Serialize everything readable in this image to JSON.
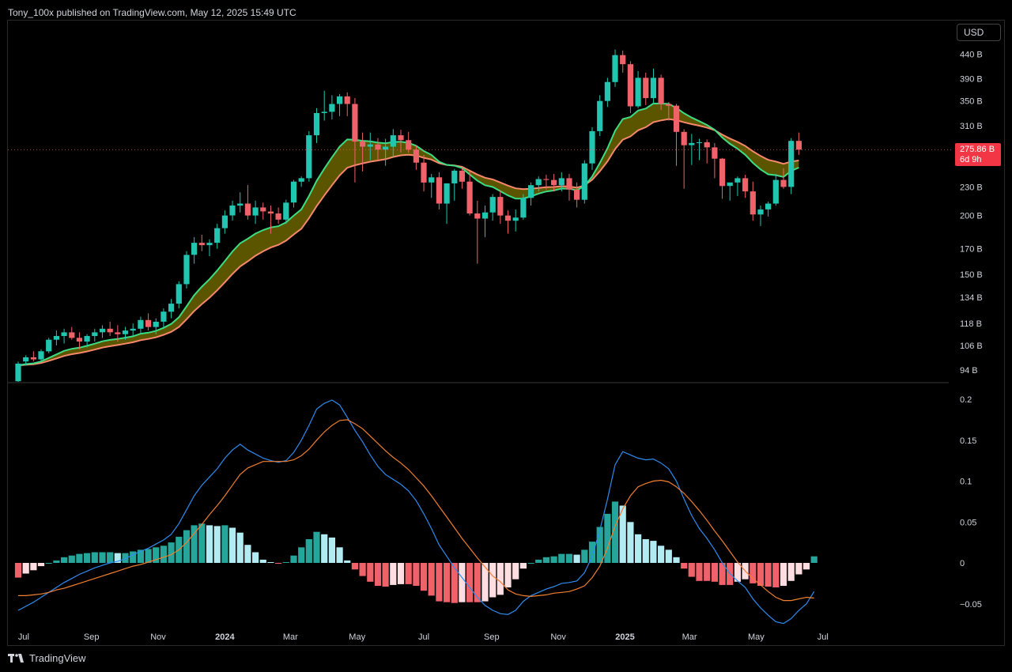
{
  "header": {
    "publisher": "Tony_100x published on TradingView.com, May 12, 2025 15:49 UTC"
  },
  "currency_button": {
    "label": "USD"
  },
  "price_badge": {
    "price": "275.86 B",
    "countdown": "6d 9h"
  },
  "footer": {
    "brand": "TradingView"
  },
  "colors": {
    "up": "#26a69a",
    "up_bright": "#22c6b0",
    "down": "#f0626a",
    "ema_fast": "#3ddc84",
    "ema_slow": "#f7886a",
    "cloud": "#6b6400",
    "macd": "#2f8cf0",
    "signal": "#f07f30",
    "hist_pos": "#26a69a",
    "hist_pos_light": "#b2ebf2",
    "hist_neg": "#f0626a",
    "hist_neg_light": "#ffdde0",
    "bg": "#000000"
  },
  "chart_data": [
    {
      "type": "candlestick",
      "title": "",
      "scale": "log",
      "interval": "1W",
      "x_range": [
        "2023-06-19",
        "2025-07-28"
      ],
      "y_ticks": [
        "440 B",
        "390 B",
        "350 B",
        "310 B",
        "230 B",
        "200 B",
        "170 B",
        "150 B",
        "134 B",
        "118 B",
        "106 B",
        "94 B"
      ],
      "x_ticks": [
        "Jul",
        "Sep",
        "Nov",
        "2024",
        "Mar",
        "May",
        "Jul",
        "Sep",
        "Nov",
        "2025",
        "Mar",
        "May",
        "Jul"
      ],
      "last_price": 275.86,
      "candles_ohlc_billions": [
        [
          89,
          98,
          85,
          97
        ],
        [
          98,
          101,
          96,
          100
        ],
        [
          100,
          103,
          98,
          99
        ],
        [
          99,
          104,
          98,
          103
        ],
        [
          103,
          110,
          102,
          109
        ],
        [
          109,
          114,
          106,
          111
        ],
        [
          111,
          115,
          107,
          113
        ],
        [
          113,
          116,
          109,
          110
        ],
        [
          110,
          113,
          104,
          108
        ],
        [
          108,
          112,
          105,
          111
        ],
        [
          111,
          115,
          108,
          113
        ],
        [
          113,
          117,
          110,
          115
        ],
        [
          115,
          119,
          111,
          113
        ],
        [
          113,
          117,
          108,
          112
        ],
        [
          112,
          116,
          109,
          114
        ],
        [
          114,
          118,
          111,
          115
        ],
        [
          115,
          122,
          112,
          120
        ],
        [
          120,
          124,
          114,
          116
        ],
        [
          116,
          121,
          112,
          119
        ],
        [
          119,
          127,
          115,
          125
        ],
        [
          125,
          133,
          121,
          130
        ],
        [
          130,
          145,
          127,
          143
        ],
        [
          143,
          168,
          140,
          165
        ],
        [
          165,
          180,
          158,
          175
        ],
        [
          175,
          182,
          168,
          173
        ],
        [
          173,
          178,
          164,
          175
        ],
        [
          175,
          192,
          170,
          188
        ],
        [
          188,
          205,
          183,
          200
        ],
        [
          200,
          215,
          195,
          210
        ],
        [
          210,
          224,
          203,
          212
        ],
        [
          212,
          232,
          196,
          200
        ],
        [
          200,
          215,
          192,
          208
        ],
        [
          208,
          213,
          196,
          204
        ],
        [
          204,
          210,
          183,
          202
        ],
        [
          202,
          208,
          192,
          196
        ],
        [
          196,
          216,
          192,
          213
        ],
        [
          213,
          238,
          208,
          236
        ],
        [
          236,
          242,
          230,
          240
        ],
        [
          240,
          302,
          236,
          296
        ],
        [
          296,
          338,
          285,
          330
        ],
        [
          330,
          368,
          318,
          332
        ],
        [
          332,
          360,
          320,
          345
        ],
        [
          345,
          362,
          325,
          358
        ],
        [
          358,
          365,
          325,
          345
        ],
        [
          345,
          355,
          235,
          287
        ],
        [
          287,
          300,
          248,
          280
        ],
        [
          280,
          300,
          262,
          283
        ],
        [
          283,
          292,
          262,
          276
        ],
        [
          276,
          291,
          255,
          280
        ],
        [
          280,
          305,
          265,
          296
        ],
        [
          296,
          304,
          272,
          289
        ],
        [
          289,
          301,
          272,
          276
        ],
        [
          276,
          282,
          250,
          259
        ],
        [
          259,
          269,
          225,
          235
        ],
        [
          235,
          245,
          218,
          241
        ],
        [
          241,
          247,
          206,
          212
        ],
        [
          212,
          228,
          192,
          234
        ],
        [
          234,
          251,
          215,
          249
        ],
        [
          249,
          252,
          228,
          236
        ],
        [
          236,
          248,
          200,
          202
        ],
        [
          202,
          215,
          158,
          197
        ],
        [
          197,
          210,
          180,
          203
        ],
        [
          203,
          222,
          195,
          219
        ],
        [
          219,
          226,
          192,
          200
        ],
        [
          200,
          205,
          183,
          195
        ],
        [
          195,
          206,
          185,
          198
        ],
        [
          198,
          222,
          196,
          218
        ],
        [
          218,
          235,
          210,
          232
        ],
        [
          232,
          242,
          225,
          239
        ],
        [
          239,
          244,
          227,
          238
        ],
        [
          238,
          245,
          225,
          232
        ],
        [
          232,
          247,
          225,
          240
        ],
        [
          240,
          245,
          215,
          227
        ],
        [
          227,
          235,
          208,
          216
        ],
        [
          216,
          262,
          212,
          258
        ],
        [
          258,
          308,
          250,
          302
        ],
        [
          302,
          360,
          295,
          350
        ],
        [
          350,
          392,
          340,
          384
        ],
        [
          384,
          450,
          375,
          438
        ],
        [
          438,
          448,
          402,
          419
        ],
        [
          419,
          425,
          330,
          341
        ],
        [
          341,
          405,
          338,
          392
        ],
        [
          392,
          402,
          343,
          355
        ],
        [
          355,
          410,
          345,
          392
        ],
        [
          392,
          398,
          335,
          345
        ],
        [
          345,
          348,
          318,
          342
        ],
        [
          342,
          345,
          255,
          301
        ],
        [
          301,
          305,
          228,
          282
        ],
        [
          282,
          298,
          256,
          285
        ],
        [
          285,
          291,
          262,
          286
        ],
        [
          286,
          290,
          258,
          279
        ],
        [
          279,
          285,
          240,
          264
        ],
        [
          264,
          265,
          217,
          231
        ],
        [
          231,
          234,
          215,
          235
        ],
        [
          235,
          242,
          220,
          240
        ],
        [
          240,
          244,
          218,
          225
        ],
        [
          225,
          236,
          195,
          201
        ],
        [
          201,
          210,
          190,
          206
        ],
        [
          206,
          214,
          199,
          212
        ],
        [
          212,
          245,
          210,
          238
        ],
        [
          238,
          252,
          228,
          230
        ],
        [
          230,
          292,
          222,
          288
        ],
        [
          288,
          300,
          269,
          275.86
        ]
      ]
    },
    {
      "type": "line",
      "title": "",
      "y_ticks": [
        "0.2",
        "0.15",
        "0.1",
        "0.05",
        "0",
        "−0.05"
      ],
      "ylim": [
        -0.08,
        0.21
      ],
      "series": [
        {
          "key": "macd",
          "values": [
            -0.058,
            -0.053,
            -0.048,
            -0.042,
            -0.036,
            -0.03,
            -0.024,
            -0.019,
            -0.014,
            -0.01,
            -0.006,
            -0.003,
            0,
            0.002,
            0.005,
            0.01,
            0.014,
            0.018,
            0.023,
            0.028,
            0.035,
            0.048,
            0.065,
            0.082,
            0.095,
            0.105,
            0.115,
            0.128,
            0.138,
            0.145,
            0.138,
            0.133,
            0.128,
            0.125,
            0.123,
            0.125,
            0.135,
            0.15,
            0.168,
            0.188,
            0.195,
            0.199,
            0.193,
            0.178,
            0.162,
            0.148,
            0.132,
            0.118,
            0.108,
            0.102,
            0.096,
            0.088,
            0.076,
            0.06,
            0.042,
            0.022,
            0.008,
            -0.006,
            -0.018,
            -0.03,
            -0.042,
            -0.052,
            -0.058,
            -0.062,
            -0.063,
            -0.058,
            -0.047,
            -0.04,
            -0.036,
            -0.032,
            -0.029,
            -0.025,
            -0.024,
            -0.022,
            -0.012,
            0.008,
            0.04,
            0.078,
            0.12,
            0.136,
            0.132,
            0.128,
            0.126,
            0.127,
            0.122,
            0.115,
            0.1,
            0.078,
            0.058,
            0.042,
            0.03,
            0.016,
            0,
            -0.013,
            -0.022,
            -0.03,
            -0.044,
            -0.055,
            -0.064,
            -0.072,
            -0.074,
            -0.068,
            -0.058,
            -0.05,
            -0.035
          ]
        },
        {
          "key": "signal",
          "values": [
            -0.04,
            -0.04,
            -0.039,
            -0.038,
            -0.036,
            -0.033,
            -0.031,
            -0.028,
            -0.025,
            -0.022,
            -0.019,
            -0.016,
            -0.013,
            -0.01,
            -0.007,
            -0.004,
            -0.002,
            0.001,
            0.004,
            0.007,
            0.01,
            0.016,
            0.025,
            0.036,
            0.047,
            0.059,
            0.07,
            0.082,
            0.095,
            0.108,
            0.116,
            0.12,
            0.124,
            0.124,
            0.124,
            0.124,
            0.126,
            0.131,
            0.139,
            0.15,
            0.16,
            0.168,
            0.174,
            0.175,
            0.17,
            0.164,
            0.155,
            0.146,
            0.137,
            0.129,
            0.122,
            0.114,
            0.104,
            0.094,
            0.082,
            0.069,
            0.056,
            0.043,
            0.03,
            0.018,
            0.006,
            -0.005,
            -0.016,
            -0.023,
            -0.033,
            -0.038,
            -0.04,
            -0.041,
            -0.04,
            -0.039,
            -0.037,
            -0.036,
            -0.035,
            -0.032,
            -0.028,
            -0.018,
            -0.004,
            0.018,
            0.045,
            0.066,
            0.082,
            0.093,
            0.097,
            0.1,
            0.101,
            0.099,
            0.093,
            0.085,
            0.075,
            0.064,
            0.052,
            0.039,
            0.027,
            0.014,
            0.001,
            -0.01,
            -0.019,
            -0.027,
            -0.035,
            -0.042,
            -0.046,
            -0.046,
            -0.044,
            -0.042,
            -0.043
          ]
        }
      ],
      "histogram": [
        -0.018,
        -0.013,
        -0.009,
        -0.004,
        0,
        0.003,
        0.007,
        0.009,
        0.011,
        0.012,
        0.013,
        0.013,
        0.013,
        0.012,
        0.012,
        0.014,
        0.016,
        0.017,
        0.019,
        0.021,
        0.025,
        0.032,
        0.04,
        0.046,
        0.048,
        0.046,
        0.045,
        0.046,
        0.043,
        0.037,
        0.022,
        0.013,
        0.004,
        0.001,
        -0.001,
        0.001,
        0.009,
        0.019,
        0.029,
        0.038,
        0.035,
        0.031,
        0.019,
        0.003,
        -0.008,
        -0.016,
        -0.023,
        -0.028,
        -0.029,
        -0.027,
        -0.026,
        -0.026,
        -0.028,
        -0.034,
        -0.04,
        -0.047,
        -0.048,
        -0.049,
        -0.048,
        -0.048,
        -0.048,
        -0.047,
        -0.042,
        -0.039,
        -0.03,
        -0.02,
        -0.007,
        0,
        0.004,
        0.007,
        0.008,
        0.011,
        0.011,
        0.01,
        0.016,
        0.026,
        0.044,
        0.06,
        0.075,
        0.07,
        0.05,
        0.035,
        0.029,
        0.027,
        0.021,
        0.016,
        0.007,
        -0.007,
        -0.017,
        -0.022,
        -0.022,
        -0.023,
        -0.027,
        -0.027,
        -0.023,
        -0.02,
        -0.025,
        -0.028,
        -0.029,
        -0.03,
        -0.028,
        -0.022,
        -0.014,
        -0.008,
        0.008
      ]
    }
  ]
}
